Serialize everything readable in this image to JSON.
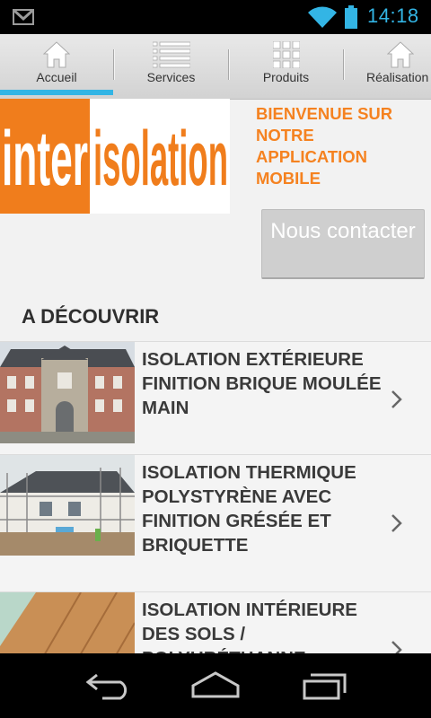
{
  "status_bar": {
    "time": "14:18"
  },
  "tabs": [
    {
      "label": "Accueil",
      "icon": "home-icon",
      "selected": true
    },
    {
      "label": "Services",
      "icon": "list-icon",
      "selected": false
    },
    {
      "label": "Produits",
      "icon": "grid-icon",
      "selected": false
    },
    {
      "label": "Réalisation",
      "icon": "home-icon",
      "selected": false
    }
  ],
  "logo": {
    "word1": "inter",
    "word2": "isolation"
  },
  "welcome_text": "BIENVENUE SUR NOTRE APPLICATION MOBILE",
  "contact_button": "Nous contacter",
  "section_title": "A DÉCOUVRIR",
  "items": [
    {
      "title": "ISOLATION EXTÉRIEURE FINITION BRIQUE MOULÉE MAIN"
    },
    {
      "title": "ISOLATION THERMIQUE POLYSTYRÈNE AVEC FINITION GRÉSÉE ET BRIQUETTE"
    },
    {
      "title": "ISOLATION INTÉRIEURE DES SOLS / POLYURÉTHANNE"
    }
  ],
  "colors": {
    "accent_blue": "#33b5e5",
    "brand_orange": "#f58220"
  }
}
